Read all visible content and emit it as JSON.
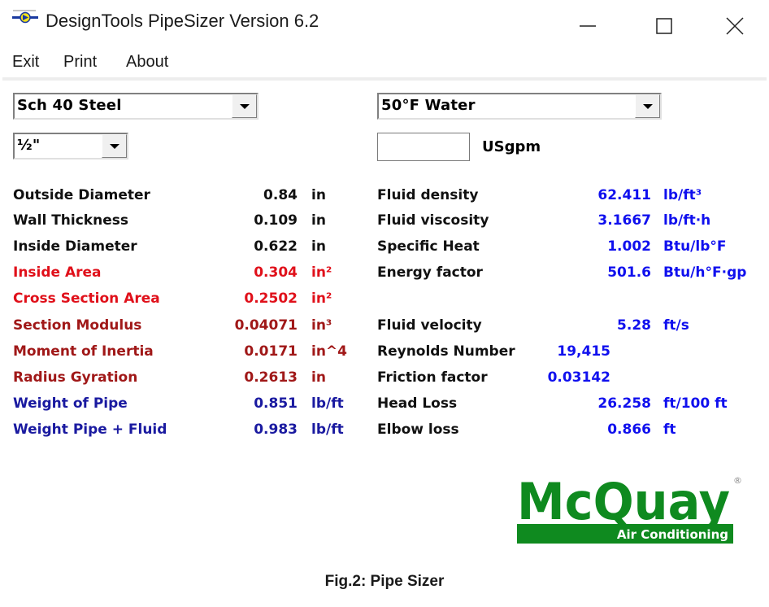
{
  "window": {
    "title": "DesignTools PipeSizer Version 6.2",
    "icon": "pipe-pump-icon",
    "controls": {
      "minimize": "minimize-icon",
      "maximize": "maximize-icon",
      "close": "close-icon"
    }
  },
  "menu": [
    {
      "label": "Exit"
    },
    {
      "label": "Print"
    },
    {
      "label": "About"
    }
  ],
  "inputs": {
    "material": {
      "selected": "Sch 40 Steel"
    },
    "pipe_size": {
      "selected": "½\""
    },
    "fluid": {
      "selected": "50°F Water"
    },
    "flow": {
      "value": "",
      "unit": "USgpm"
    }
  },
  "pipe_properties": [
    {
      "label": "Outside Diameter",
      "value": "0.84",
      "unit": "in",
      "color": "#111111"
    },
    {
      "label": "Wall Thickness",
      "value": "0.109",
      "unit": "in",
      "color": "#111111"
    },
    {
      "label": "Inside Diameter",
      "value": "0.622",
      "unit": "in",
      "color": "#111111"
    },
    {
      "label": "Inside Area",
      "value": "0.304",
      "unit": "in²",
      "color": "#e0101a"
    },
    {
      "label": "Cross Section Area",
      "value": "0.2502",
      "unit": "in²",
      "color": "#e0101a"
    },
    {
      "label": "Section Modulus",
      "value": "0.04071",
      "unit": "in³",
      "color": "#a01818"
    },
    {
      "label": "Moment of Inertia",
      "value": "0.0171",
      "unit": "in^4",
      "color": "#a01818"
    },
    {
      "label": "Radius Gyration",
      "value": "0.2613",
      "unit": "in",
      "color": "#a01818"
    },
    {
      "label": "Weight of Pipe",
      "value": "0.851",
      "unit": "lb/ft",
      "color": "#1a1aa0"
    },
    {
      "label": "Weight Pipe + Fluid",
      "value": "0.983",
      "unit": "lb/ft",
      "color": "#1a1aa0"
    }
  ],
  "fluid_properties": [
    {
      "label": "Fluid density",
      "value": "62.411",
      "unit": "lb/ft³"
    },
    {
      "label": "Fluid viscosity",
      "value": "3.1667",
      "unit": "lb/ft·h"
    },
    {
      "label": "Specific Heat",
      "value": "1.002",
      "unit": "Btu/lb°F"
    },
    {
      "label": "Energy factor",
      "value": "501.6",
      "unit": "Btu/h°F·gp"
    }
  ],
  "flow_results": [
    {
      "label": "Fluid velocity",
      "value": "5.28",
      "unit": "ft/s"
    },
    {
      "label": "Reynolds Number",
      "value": "19,415",
      "unit": ""
    },
    {
      "label": "Friction factor",
      "value": "0.03142",
      "unit": ""
    },
    {
      "label": "Head Loss",
      "value": "26.258",
      "unit": "ft/100 ft"
    },
    {
      "label": "Elbow loss",
      "value": "0.866",
      "unit": "ft"
    }
  ],
  "colors": {
    "label_dark": "#111111",
    "value_blue": "#1010ee",
    "logo_green": "#0f8a1f"
  },
  "logo": {
    "brand": "McQuay",
    "tagline": "Air Conditioning",
    "mark": "®"
  },
  "caption": "Fig.2: Pipe Sizer"
}
